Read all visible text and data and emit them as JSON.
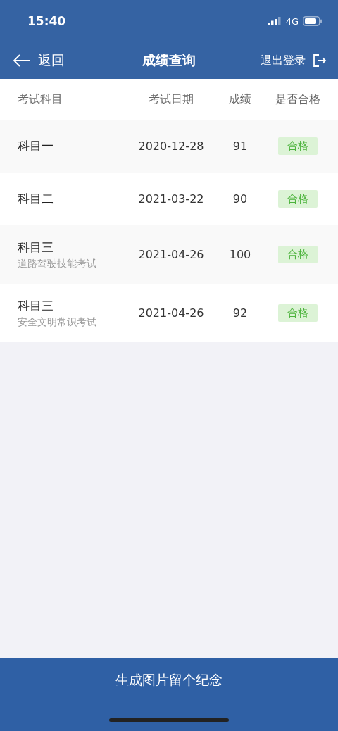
{
  "status_bar": {
    "time": "15:40",
    "network": "4G"
  },
  "nav": {
    "back": "返回",
    "title": "成绩查询",
    "logout": "退出登录"
  },
  "table": {
    "columns": [
      "考试科目",
      "考试日期",
      "成绩",
      "是否合格"
    ],
    "rows": [
      {
        "subject": "科目一",
        "date": "2020-12-28",
        "score": "91",
        "result": "合格",
        "passed": true
      },
      {
        "subject": "科目二",
        "date": "2021-03-22",
        "score": "90",
        "result": "合格",
        "passed": true
      },
      {
        "subject": "科目三",
        "note": "道路驾驶技能考试",
        "date": "2021-04-26",
        "score": "100",
        "result": "合格",
        "passed": true
      },
      {
        "subject": "科目三",
        "note": "安全文明常识考试",
        "date": "2021-04-26",
        "score": "92",
        "result": "合格",
        "passed": true
      }
    ]
  },
  "footer_button": "生成图片留个纪念"
}
